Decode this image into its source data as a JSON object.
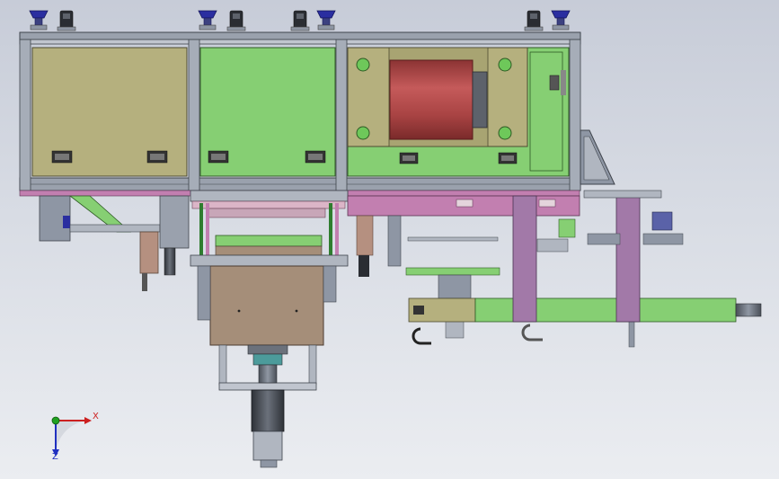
{
  "viewport": {
    "background_top": "#c7ccd8",
    "background_bottom": "#ebedf1"
  },
  "colors": {
    "khaki": "#b5b07e",
    "green": "#86cf73",
    "pink": "#c27fb0",
    "purple": "#a279a8",
    "brown": "#a58e79",
    "red_cylinder": "#b54848",
    "steel": "#8e96a4",
    "frame_dark": "#4d535d",
    "blue_knob": "#2a2ea0",
    "axis_x": "#cc2020",
    "axis_y": "#20a020",
    "axis_z": "#2030c0"
  },
  "triad": {
    "x_label": "X",
    "z_label": "Z",
    "x_icon": "triad-x-arrow-icon",
    "y_icon": "triad-y-dot-icon",
    "z_icon": "triad-z-arrow-icon"
  }
}
